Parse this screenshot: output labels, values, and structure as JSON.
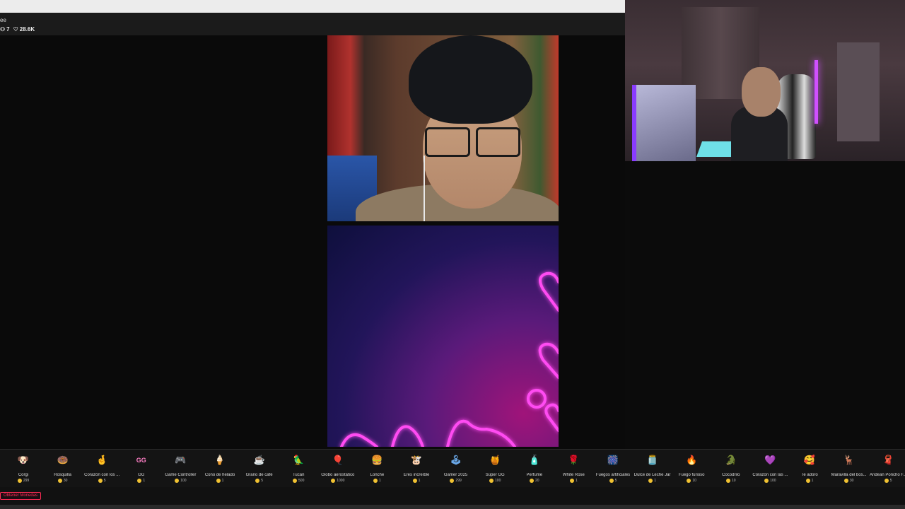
{
  "header": {
    "name_partial": "ee",
    "stats": [
      {
        "icon": "people-icon",
        "value": "7"
      },
      {
        "icon": "heart-icon",
        "value": "28.6K"
      }
    ]
  },
  "gifts": [
    {
      "name": "Corgi",
      "cost": "299",
      "icon": "🐶",
      "color": "#f4b183"
    },
    {
      "name": "Rosquilla",
      "cost": "30",
      "icon": "🍩",
      "color": "#f3a6c8"
    },
    {
      "name": "Corazón con los ...",
      "cost": "5",
      "icon": "🤞",
      "color": "#e9b28f"
    },
    {
      "name": "GG",
      "cost": "1",
      "icon": "GG",
      "color": "#ff7fc6"
    },
    {
      "name": "Game Controller",
      "cost": "100",
      "icon": "🎮",
      "color": "#9fb6d4"
    },
    {
      "name": "Cono de helado",
      "cost": "1",
      "icon": "🍦",
      "color": "#f7c6e0"
    },
    {
      "name": "Grano de café",
      "cost": "5",
      "icon": "☕",
      "color": "#c9a06b"
    },
    {
      "name": "Tucán",
      "cost": "500",
      "icon": "🦜",
      "color": "#7bc96f"
    },
    {
      "name": "Globo aerostático",
      "cost": "1000",
      "icon": "🎈",
      "color": "#8fd0c0"
    },
    {
      "name": "Lonche",
      "cost": "1",
      "icon": "🍔",
      "color": "#e8a54b"
    },
    {
      "name": "Eres increíble",
      "cost": "1",
      "icon": "🐮",
      "color": "#d9b48a"
    },
    {
      "name": "Gamer 2025",
      "cost": "299",
      "icon": "🕹",
      "color": "#6aa8e8"
    },
    {
      "name": "Súper GG",
      "cost": "100",
      "icon": "🍯",
      "color": "#f5d38a"
    },
    {
      "name": "Perfume",
      "cost": "20",
      "icon": "🧴",
      "color": "#f08ab8"
    },
    {
      "name": "White Rose",
      "cost": "1",
      "icon": "🌹",
      "color": "#d8e8d0"
    },
    {
      "name": "Fuegos artificiales",
      "cost": "5",
      "icon": "🎆",
      "color": "#8a7bff"
    },
    {
      "name": "Dulce de Leche Jar",
      "cost": "1",
      "icon": "🫙",
      "color": "#d98b4a"
    },
    {
      "name": "Fuego furioso",
      "cost": "10",
      "icon": "🔥",
      "color": "#ff8a3a"
    },
    {
      "name": "Cocodrilo",
      "cost": "10",
      "icon": "🐊",
      "color": "#5ecb5e"
    },
    {
      "name": "Corazón con las ...",
      "cost": "100",
      "icon": "💜",
      "color": "#d59be8"
    },
    {
      "name": "Te adoro",
      "cost": "1",
      "icon": "🥰",
      "color": "#ff4a5a"
    },
    {
      "name": "Maravilla del bos...",
      "cost": "30",
      "icon": "🦌",
      "color": "#b98a5a"
    },
    {
      "name": "Andean Poncho F...",
      "cost": "5",
      "icon": "🧣",
      "color": "#e05aa0"
    }
  ],
  "coins_button": "Obtener Monedas",
  "colors": {
    "accent": "#fe2c55",
    "coin": "#f1c232",
    "neon": "#ff3cf0"
  }
}
